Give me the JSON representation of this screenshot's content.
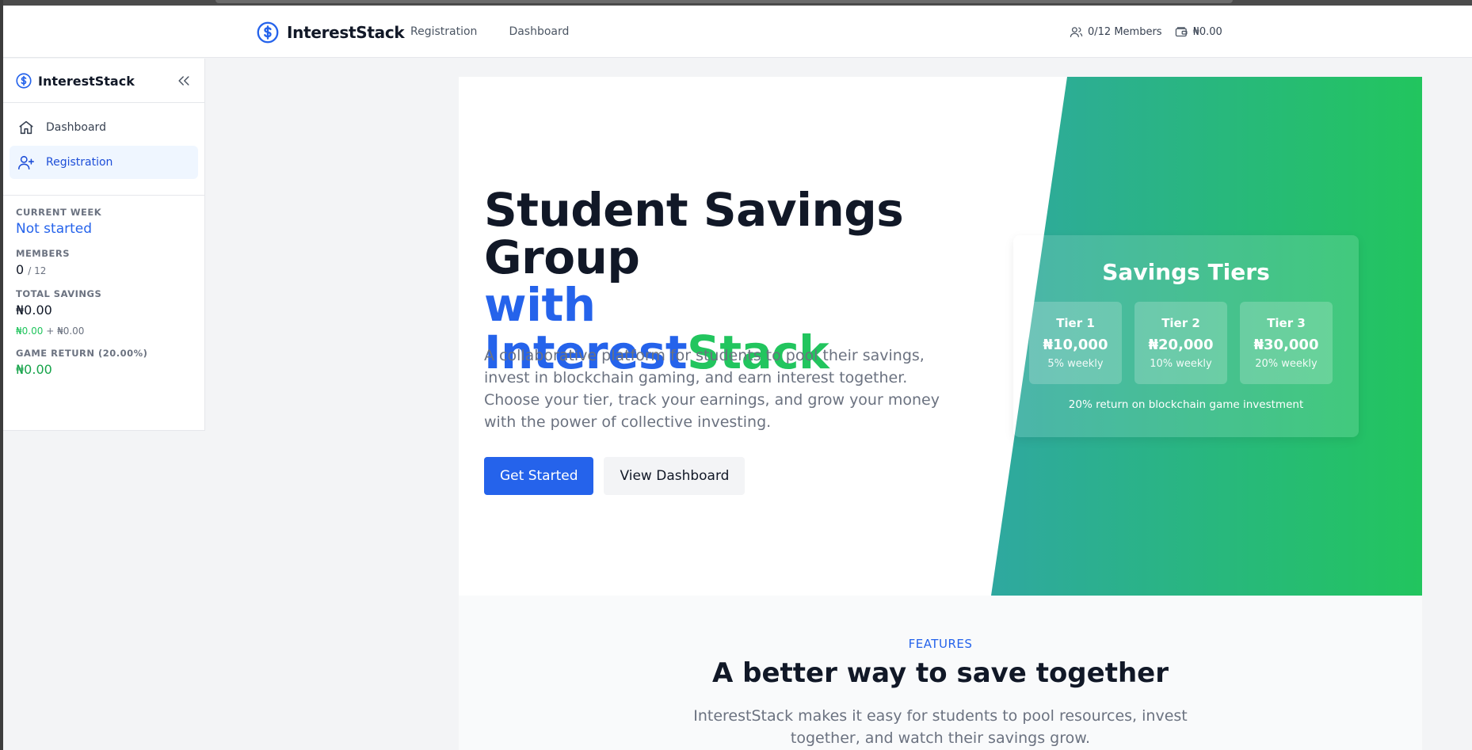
{
  "topbar": {
    "brand": "InterestStack",
    "nav": [
      "Registration",
      "Dashboard"
    ],
    "members": "0/12 Members",
    "balance": "₦0.00"
  },
  "sidebar": {
    "brand": "InterestStack",
    "items": [
      {
        "label": "Dashboard",
        "icon": "home-icon"
      },
      {
        "label": "Registration",
        "icon": "user-plus-icon"
      }
    ],
    "current_week": {
      "label": "CURRENT WEEK",
      "value": "Not started"
    },
    "members": {
      "label": "MEMBERS",
      "value": "0",
      "total": "/ 12"
    },
    "total_savings": {
      "label": "TOTAL SAVINGS",
      "value": "₦0.00",
      "part_a": "₦0.00",
      "plus": "+",
      "part_b": "₦0.00"
    },
    "game_return": {
      "label": "GAME RETURN (20.00%)",
      "value": "₦0.00"
    }
  },
  "hero": {
    "title_line1": "Student Savings",
    "title_line2": "Group",
    "title_with": "with Interest",
    "title_stack": "Stack",
    "description": "A collaborative platform for students to pool their savings, invest in blockchain gaming, and earn interest together. Choose your tier, track your earnings, and grow your money with the power of collective investing.",
    "primary_button": "Get Started",
    "secondary_button": "View Dashboard",
    "gradient_from": "#3b86e2",
    "gradient_to": "#22c55e"
  },
  "tiers": {
    "title": "Savings Tiers",
    "items": [
      {
        "name": "Tier 1",
        "amount": "₦10,000",
        "rate": "5% weekly"
      },
      {
        "name": "Tier 2",
        "amount": "₦20,000",
        "rate": "10% weekly"
      },
      {
        "name": "Tier 3",
        "amount": "₦30,000",
        "rate": "20% weekly"
      }
    ],
    "note": "20% return on blockchain game investment"
  },
  "features": {
    "eyebrow": "FEATURES",
    "title": "A better way to save together",
    "subtitle": "InterestStack makes it easy for students to pool resources, invest together, and watch their savings grow."
  },
  "colors": {
    "accent": "#2563eb",
    "success": "#22c55e"
  }
}
